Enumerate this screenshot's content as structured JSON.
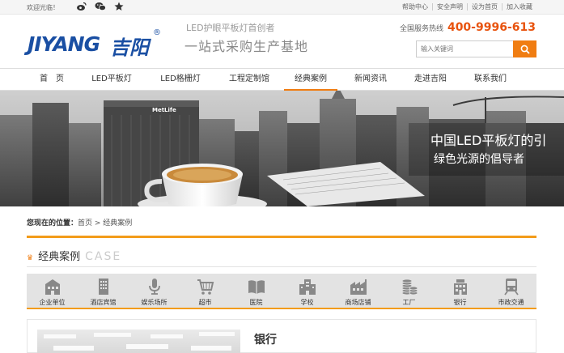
{
  "topbar": {
    "welcome": "欢迎光临！",
    "social_icons": [
      "weibo-icon",
      "wechat-icon",
      "star-icon"
    ],
    "links": [
      "帮助中心",
      "安全声明",
      "设为首页",
      "加入收藏"
    ]
  },
  "header": {
    "logo_en": "JIYANG",
    "logo_cn": "吉阳",
    "logo_reg": "®",
    "slogan_line1": "LED护眼平板灯首创者",
    "slogan_line2": "一站式采购生产基地",
    "hotline_label": "全国服务热线",
    "hotline_number": "400-9996-613",
    "search_placeholder": "输入关键词"
  },
  "nav": {
    "items": [
      "首　页",
      "LED平板灯",
      "LED格栅灯",
      "工程定制馆",
      "经典案例",
      "新闻资讯",
      "走进吉阳",
      "联系我们"
    ],
    "active_index": 4
  },
  "banner": {
    "line1": "中国LED平板灯的引",
    "line2": "绿色光源的倡导者",
    "building_sign": "MetLife"
  },
  "breadcrumb": {
    "label": "您现在的位置：",
    "items": [
      "首页",
      "经典案例"
    ],
    "separator": " > "
  },
  "section": {
    "title_cn": "经典案例",
    "title_en": "CASE"
  },
  "categories": [
    {
      "label": "企业单位",
      "icon": "factory-building-icon"
    },
    {
      "label": "酒店宾馆",
      "icon": "hotel-icon"
    },
    {
      "label": "娱乐场所",
      "icon": "microphone-icon"
    },
    {
      "label": "超市",
      "icon": "shopping-cart-icon"
    },
    {
      "label": "医院",
      "icon": "book-icon"
    },
    {
      "label": "学校",
      "icon": "school-building-icon"
    },
    {
      "label": "商场店铺",
      "icon": "shop-icon"
    },
    {
      "label": "工厂",
      "icon": "coins-icon"
    },
    {
      "label": "银行",
      "icon": "bank-icon"
    },
    {
      "label": "市政交通",
      "icon": "train-icon"
    }
  ],
  "case_detail": {
    "title": "银行"
  },
  "colors": {
    "accent": "#f07d12",
    "brand_blue": "#1a4fa3",
    "hotline": "#e8530e"
  }
}
